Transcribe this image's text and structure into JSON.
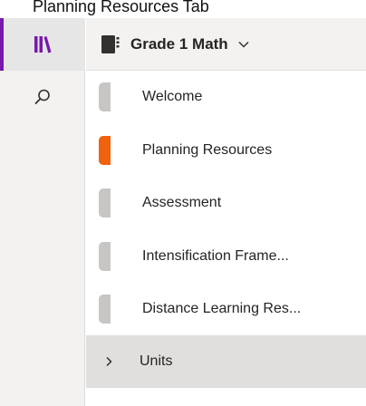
{
  "caption": "Planning Resources Tab",
  "colors": {
    "accent": "#7719aa",
    "active_section": "#f2610c",
    "inactive_section": "#c8c6c4"
  },
  "rail": {
    "items": [
      {
        "icon": "library-icon",
        "active": true
      },
      {
        "icon": "search-icon",
        "active": false
      }
    ]
  },
  "notebook": {
    "icon": "notebook-icon",
    "title": "Grade 1 Math",
    "chevron": "chevron-down-icon"
  },
  "sections": [
    {
      "label": "Welcome",
      "color": "#c8c6c4"
    },
    {
      "label": "Planning Resources",
      "color": "#f2610c"
    },
    {
      "label": "Assessment",
      "color": "#c8c6c4"
    },
    {
      "label": "Intensification Frame...",
      "color": "#c8c6c4"
    },
    {
      "label": "Distance Learning Res...",
      "color": "#c8c6c4"
    }
  ],
  "section_group": {
    "label": "Units",
    "chevron": "chevron-right-icon"
  }
}
